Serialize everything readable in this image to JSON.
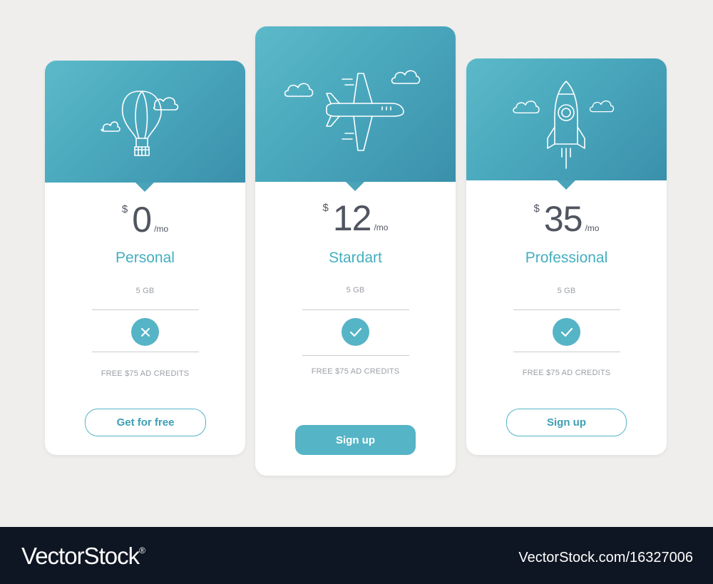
{
  "plans": [
    {
      "currency": "$",
      "amount": "0",
      "period": "/mo",
      "name": "Personal",
      "storage": "5 GB",
      "included": false,
      "feature": "FREE $75 AD CREDITS",
      "button": "Get for free",
      "icon": "hot-air-balloon-icon"
    },
    {
      "currency": "$",
      "amount": "12",
      "period": "/mo",
      "name": "Stardart",
      "storage": "5 GB",
      "included": true,
      "feature": "FREE $75 AD CREDITS",
      "button": "Sign up",
      "icon": "airplane-icon"
    },
    {
      "currency": "$",
      "amount": "35",
      "period": "/mo",
      "name": "Professional",
      "storage": "5 GB",
      "included": true,
      "feature": "FREE $75 AD CREDITS",
      "button": "Sign up",
      "icon": "rocket-icon"
    }
  ],
  "colors": {
    "accent": "#55b4c6",
    "header_gradient": [
      "#5bb9c9",
      "#3a90ab"
    ],
    "background": "#efeeec",
    "footer": "#0f1623"
  },
  "footer": {
    "brand": "VectorStock",
    "registered": "®",
    "url": "VectorStock.com/16327006"
  }
}
